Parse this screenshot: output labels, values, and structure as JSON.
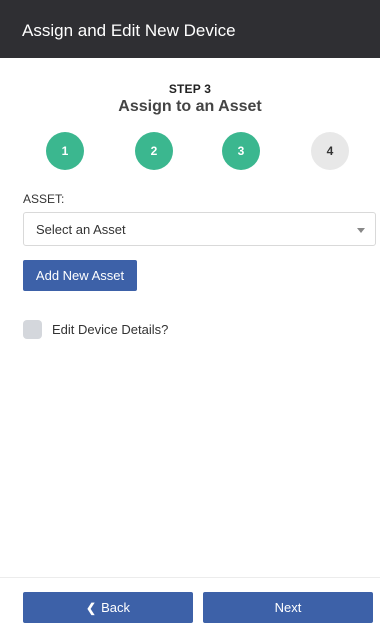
{
  "header": {
    "title": "Assign and Edit New Device"
  },
  "step": {
    "number_label": "STEP 3",
    "title": "Assign to an Asset"
  },
  "steps": [
    {
      "label": "1",
      "state": "done"
    },
    {
      "label": "2",
      "state": "done"
    },
    {
      "label": "3",
      "state": "done"
    },
    {
      "label": "4",
      "state": "todo"
    }
  ],
  "asset": {
    "label": "ASSET:",
    "selected": "Select an Asset"
  },
  "add_asset_label": "Add New Asset",
  "edit_details": {
    "label": "Edit Device Details?",
    "checked": false
  },
  "footer": {
    "back_label": "Back",
    "next_label": "Next"
  },
  "colors": {
    "header_bg": "#2f2f33",
    "step_done": "#3bb78f",
    "step_todo": "#e8e8e8",
    "primary": "#3d61a8"
  },
  "icons": {
    "back": "chevron-left-icon",
    "select": "caret-down-icon"
  }
}
